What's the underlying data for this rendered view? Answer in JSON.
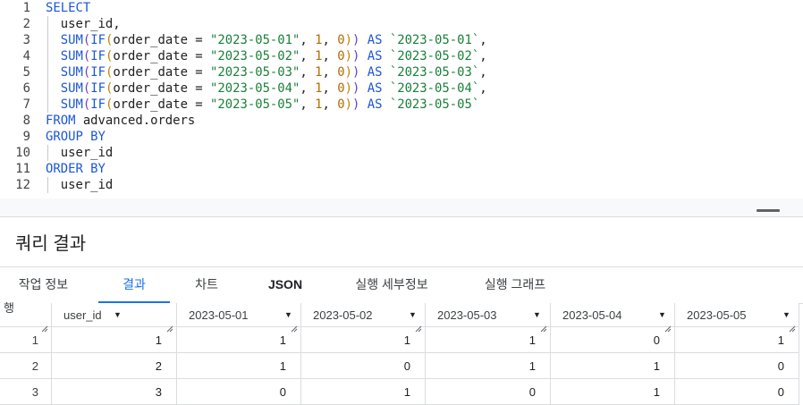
{
  "editor": {
    "lines": [
      {
        "n": "1",
        "html": "<span class=\"kw\">SELECT</span>"
      },
      {
        "n": "2",
        "html": "  user_id,",
        "guide": true
      },
      {
        "n": "3",
        "html": "  <span class=\"kw\">SUM</span><span class=\"p1\">(</span><span class=\"kw\">IF</span><span class=\"p2\">(</span>order_date = <span class=\"str\">\"2023-05-01\"</span>, <span class=\"num\">1</span>, <span class=\"num\">0</span><span class=\"p2\">)</span><span class=\"p1\">)</span> <span class=\"kw\">AS</span> <span class=\"bt\">`2023-05-01`</span>,",
        "guide": true
      },
      {
        "n": "4",
        "html": "  <span class=\"kw\">SUM</span><span class=\"p1\">(</span><span class=\"kw\">IF</span><span class=\"p2\">(</span>order_date = <span class=\"str\">\"2023-05-02\"</span>, <span class=\"num\">1</span>, <span class=\"num\">0</span><span class=\"p2\">)</span><span class=\"p1\">)</span> <span class=\"kw\">AS</span> <span class=\"bt\">`2023-05-02`</span>,",
        "guide": true
      },
      {
        "n": "5",
        "html": "  <span class=\"kw\">SUM</span><span class=\"p1\">(</span><span class=\"kw\">IF</span><span class=\"p2\">(</span>order_date = <span class=\"str\">\"2023-05-03\"</span>, <span class=\"num\">1</span>, <span class=\"num\">0</span><span class=\"p2\">)</span><span class=\"p1\">)</span> <span class=\"kw\">AS</span> <span class=\"bt\">`2023-05-03`</span>,",
        "guide": true
      },
      {
        "n": "6",
        "html": "  <span class=\"kw\">SUM</span><span class=\"p1\">(</span><span class=\"kw\">IF</span><span class=\"p2\">(</span>order_date = <span class=\"str\">\"2023-05-04\"</span>, <span class=\"num\">1</span>, <span class=\"num\">0</span><span class=\"p2\">)</span><span class=\"p1\">)</span> <span class=\"kw\">AS</span> <span class=\"bt\">`2023-05-04`</span>,",
        "guide": true
      },
      {
        "n": "7",
        "html": "  <span class=\"kw\">SUM</span><span class=\"p1\">(</span><span class=\"kw\">IF</span><span class=\"p2\">(</span>order_date = <span class=\"str\">\"2023-05-05\"</span>, <span class=\"num\">1</span>, <span class=\"num\">0</span><span class=\"p2\">)</span><span class=\"p1\">)</span> <span class=\"kw\">AS</span> <span class=\"bt\">`2023-05-05`</span>",
        "guide": true
      },
      {
        "n": "8",
        "html": "<span class=\"kw\">FROM</span> advanced.orders"
      },
      {
        "n": "9",
        "html": "<span class=\"kw\">GROUP BY</span>"
      },
      {
        "n": "10",
        "html": "  user_id",
        "guide": true
      },
      {
        "n": "11",
        "html": "<span class=\"kw\">ORDER BY</span>"
      },
      {
        "n": "12",
        "html": "  user_id",
        "guide": true
      }
    ]
  },
  "results": {
    "title": "쿼리 결과",
    "tabs": [
      {
        "label": "작업 정보",
        "name": "tab-job-info"
      },
      {
        "label": "결과",
        "name": "tab-results",
        "active": true
      },
      {
        "label": "차트",
        "name": "tab-chart"
      },
      {
        "label": "JSON",
        "name": "tab-json",
        "bold": true
      },
      {
        "label": "실행 세부정보",
        "name": "tab-execution-details"
      },
      {
        "label": "실행 그래프",
        "name": "tab-execution-graph"
      }
    ],
    "row_header": "행",
    "columns": [
      "user_id",
      "2023-05-01",
      "2023-05-02",
      "2023-05-03",
      "2023-05-04",
      "2023-05-05"
    ],
    "rows": [
      {
        "row": "1",
        "values": [
          "1",
          "1",
          "1",
          "1",
          "0",
          "1"
        ]
      },
      {
        "row": "2",
        "values": [
          "2",
          "1",
          "0",
          "1",
          "1",
          "0"
        ]
      },
      {
        "row": "3",
        "values": [
          "3",
          "0",
          "1",
          "0",
          "1",
          "0"
        ]
      }
    ]
  }
}
